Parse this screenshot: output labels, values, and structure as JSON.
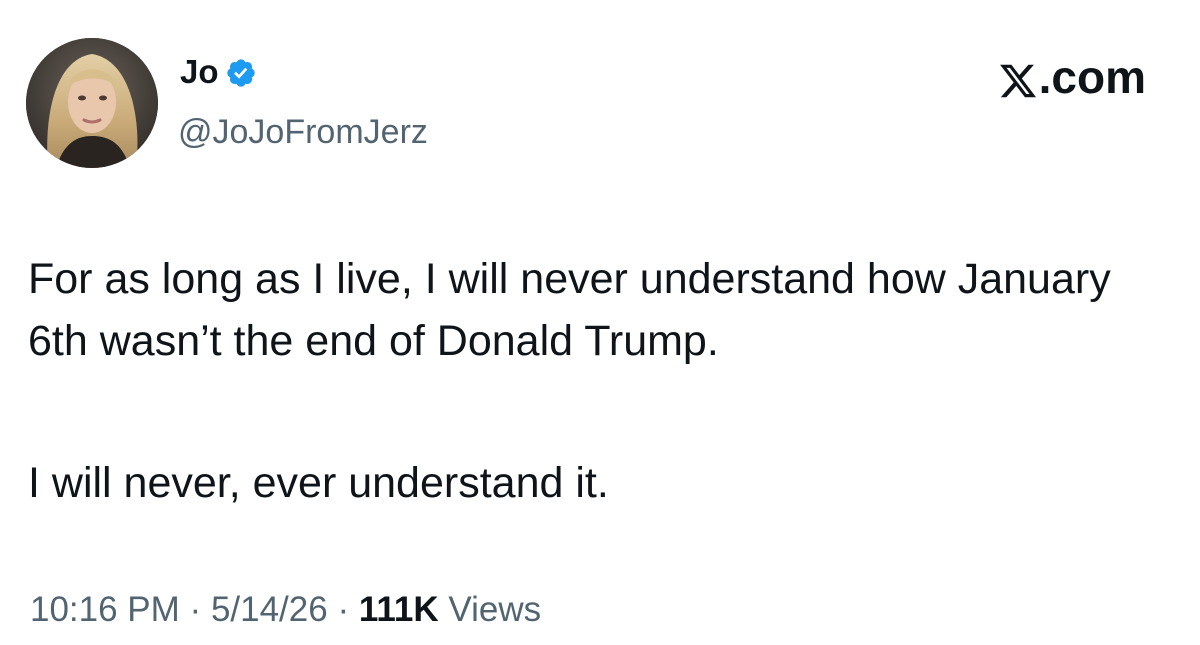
{
  "author": {
    "display_name": "Jo",
    "handle": "@JoJoFromJerz",
    "verified_icon": "verified-badge-icon",
    "verified_color": "#1d9bf0"
  },
  "brand": {
    "text": ".com",
    "icon": "x-logo-icon"
  },
  "tweet": {
    "paragraphs": [
      "For as long as I live, I will never understand how January 6th wasn’t the end of Donald Trump.",
      "I will never, ever understand it."
    ]
  },
  "meta": {
    "time": "10:16 PM",
    "separator": "·",
    "date": "5/14/26",
    "views_count": "111K",
    "views_label": "Views"
  },
  "colors": {
    "text": "#0f1419",
    "secondary": "#536471",
    "background": "#ffffff"
  }
}
